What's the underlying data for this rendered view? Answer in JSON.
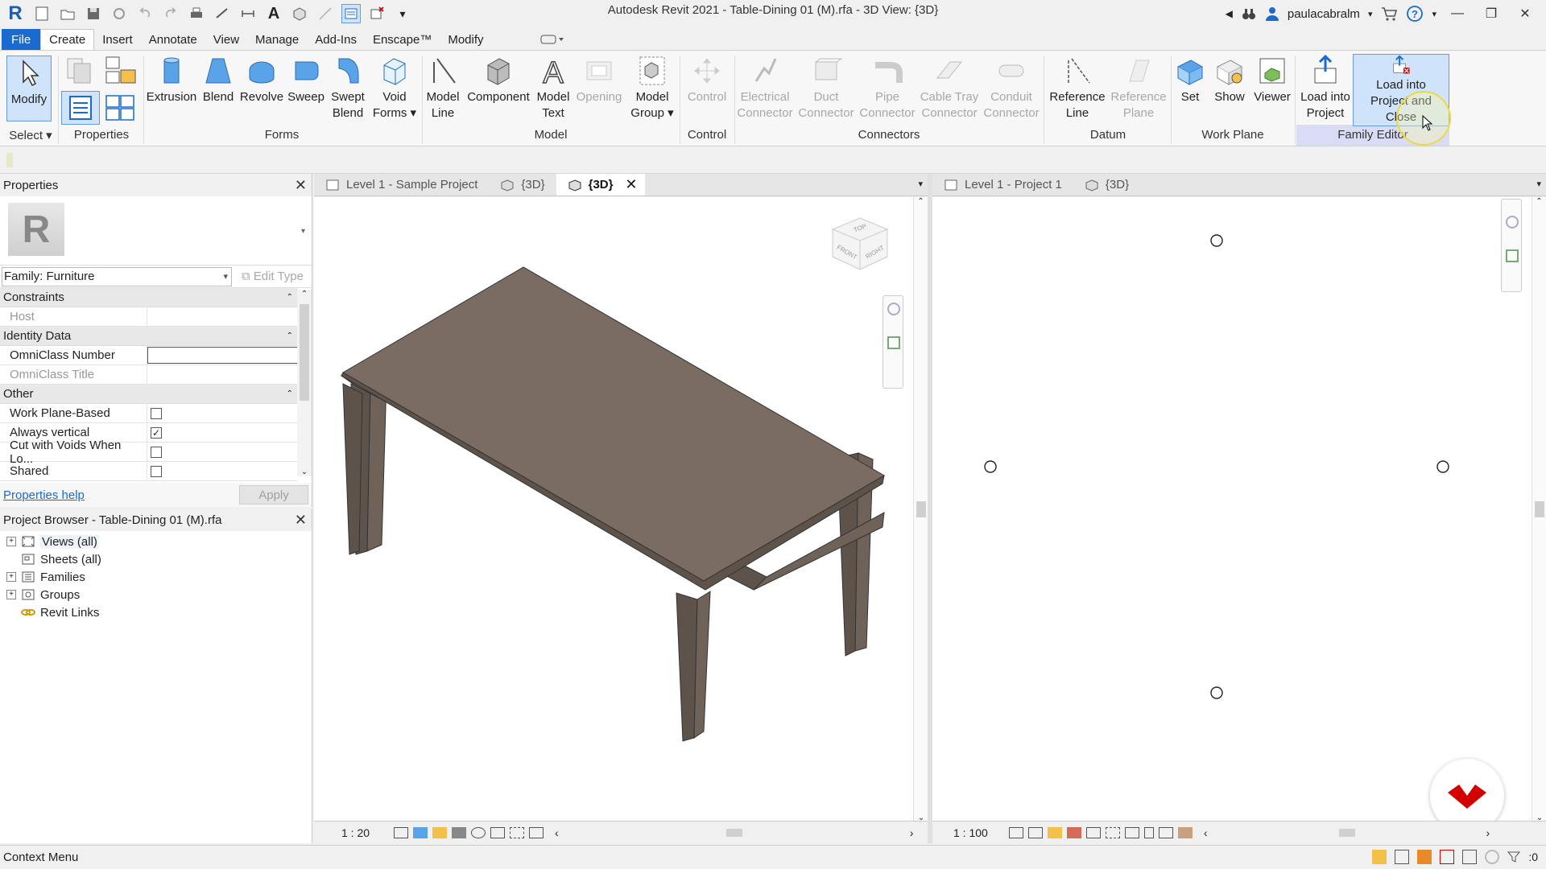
{
  "window": {
    "title": "Autodesk Revit 2021 - Table-Dining 01 (M).rfa - 3D View: {3D}",
    "username": "paulacabralm"
  },
  "menu_tabs": [
    "File",
    "Create",
    "Insert",
    "Annotate",
    "View",
    "Manage",
    "Add-Ins",
    "Enscape™",
    "Modify"
  ],
  "active_tab": "Create",
  "ribbon": {
    "select": {
      "modify_label": "Modify",
      "panel": "Select"
    },
    "properties_panel": "Properties",
    "forms": {
      "panel": "Forms",
      "tools": [
        "Extrusion",
        "Blend",
        "Revolve",
        "Sweep",
        "Swept Blend",
        "Void Forms"
      ]
    },
    "model": {
      "panel": "Model",
      "tools": [
        "Model Line",
        "Component",
        "Model Text",
        "Opening",
        "Model Group"
      ]
    },
    "control": {
      "panel": "Control",
      "tool": "Control"
    },
    "connectors": {
      "panel": "Connectors",
      "tools": [
        "Electrical Connector",
        "Duct Connector",
        "Pipe Connector",
        "Cable Tray Connector",
        "Conduit Connector"
      ]
    },
    "datum": {
      "panel": "Datum",
      "tools": [
        "Reference Line",
        "Reference Plane"
      ]
    },
    "work_plane": {
      "panel": "Work Plane",
      "tools": [
        "Set",
        "Show",
        "Viewer"
      ]
    },
    "family_editor": {
      "panel": "Family Editor",
      "tools": [
        "Load into Project",
        "Load into Project and Close"
      ]
    }
  },
  "properties": {
    "title": "Properties",
    "family": "Family: Furniture",
    "edit_type": "Edit Type",
    "groups": {
      "constraints": "Constraints",
      "identity": "Identity Data",
      "other": "Other"
    },
    "rows": {
      "host": "Host",
      "omniclass_number": "OmniClass Number",
      "omniclass_title": "OmniClass Title",
      "work_plane_based": "Work Plane-Based",
      "always_vertical": "Always vertical",
      "cut_with_voids": "Cut with Voids When Lo...",
      "shared": "Shared"
    },
    "checks": {
      "work_plane_based": false,
      "always_vertical": true,
      "cut_with_voids": false,
      "shared": false
    },
    "help_link": "Properties help",
    "apply": "Apply"
  },
  "project_browser": {
    "title": "Project Browser - Table-Dining 01 (M).rfa",
    "items": [
      "Views (all)",
      "Sheets (all)",
      "Families",
      "Groups",
      "Revit Links"
    ]
  },
  "view_left": {
    "tabs": [
      "Level 1 - Sample Project",
      "{3D}",
      "{3D}"
    ],
    "scale": "1 : 20",
    "viewcube": {
      "top": "TOP",
      "front": "FRONT",
      "right": "RIGHT"
    }
  },
  "view_right": {
    "tabs": [
      "Level 1 - Project 1",
      "{3D}"
    ],
    "scale": "1 : 100"
  },
  "status": {
    "text": "Context Menu",
    "filter_count": ":0"
  },
  "colors": {
    "file_tab": "#1b6ad0",
    "highlight_panel": "#d9dcf5",
    "table_top": "#7a6c62",
    "table_side": "#5e534b",
    "logo_red": "#d40000"
  }
}
